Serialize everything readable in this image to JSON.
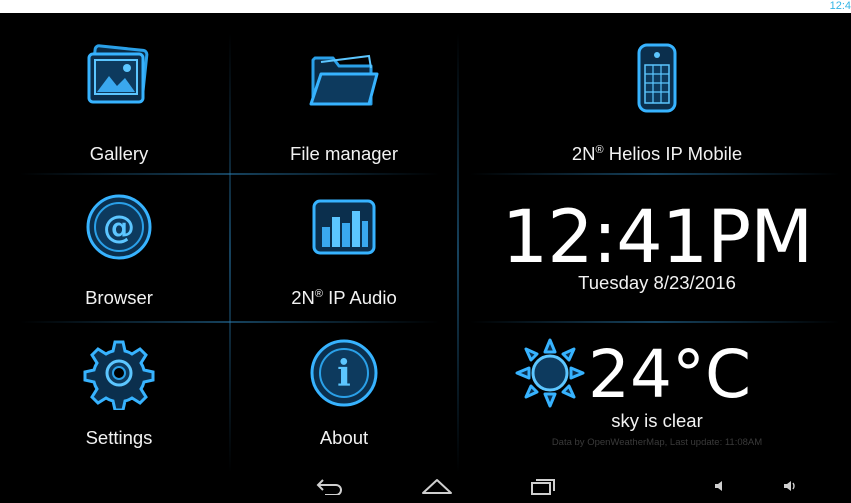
{
  "status_bar": {
    "time": "12:4"
  },
  "apps": [
    {
      "label": "Gallery",
      "icon": "gallery-icon"
    },
    {
      "label": "File manager",
      "icon": "folder-icon"
    },
    {
      "label": "Browser",
      "icon": "at-sign-icon"
    },
    {
      "label": "IP Audio",
      "brand": "2N",
      "icon": "equalizer-icon"
    },
    {
      "label": "Settings",
      "icon": "gear-icon"
    },
    {
      "label": "About",
      "icon": "info-icon"
    }
  ],
  "helios": {
    "brand": "2N",
    "label": "Helios IP Mobile",
    "icon": "intercom-icon",
    "registered": "®"
  },
  "clock": {
    "time": "12:41PM",
    "date": "Tuesday 8/23/2016"
  },
  "weather": {
    "temperature": "24°C",
    "description": "sky is clear",
    "source": "Data by OpenWeatherMap, Last update: 11:08AM",
    "icon": "sun-icon"
  },
  "navigation": {
    "back": "back-icon",
    "home": "home-icon",
    "recents": "recent-apps-icon",
    "volume_down": "volume-down-icon",
    "volume_up": "volume-up-icon"
  },
  "colors": {
    "accent": "#33b5e5",
    "icon_glow": "#1e90d8",
    "background": "#000000"
  }
}
